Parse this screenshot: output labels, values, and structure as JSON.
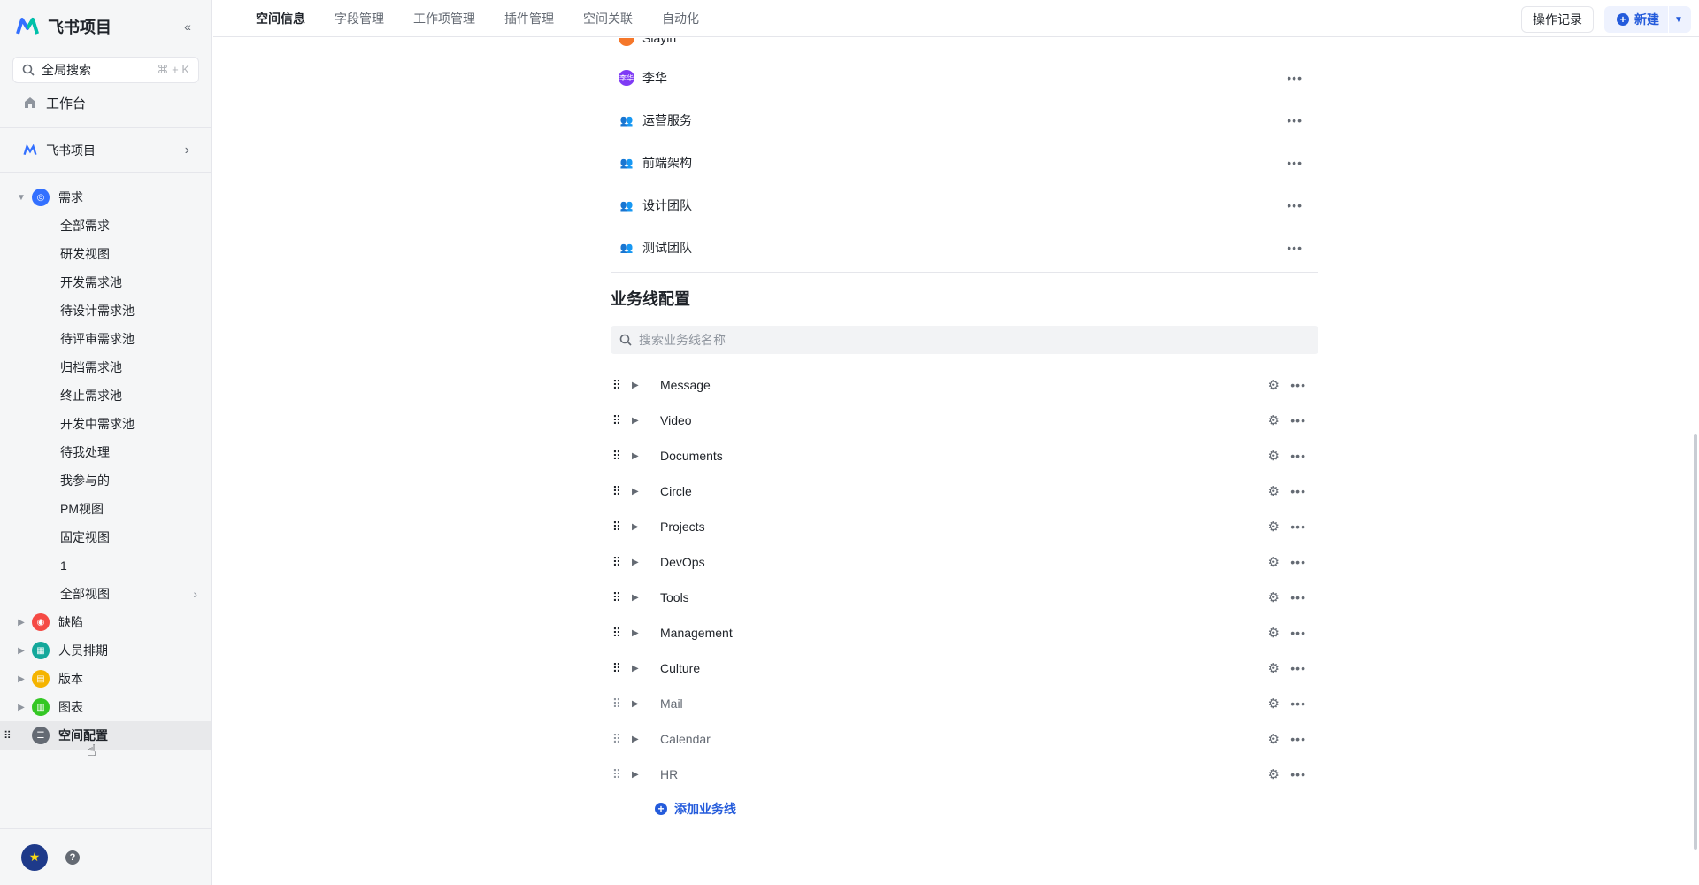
{
  "app": {
    "name": "飞书项目"
  },
  "sidebar": {
    "search_placeholder": "全局搜索",
    "search_shortcut": "⌘ + K",
    "workbench": "工作台",
    "space_name": "飞书项目",
    "groups": [
      {
        "label": "需求",
        "color": "#3370ff",
        "expanded": true
      },
      {
        "label": "缺陷",
        "color": "#f54a45"
      },
      {
        "label": "人员排期",
        "color": "#2ea121"
      },
      {
        "label": "版本",
        "color": "#f5b400"
      },
      {
        "label": "图表",
        "color": "#34c724"
      },
      {
        "label": "空间配置",
        "color": "#646a73",
        "active": true
      }
    ],
    "requirement_views": [
      "全部需求",
      "研发视图",
      "开发需求池",
      "待设计需求池",
      "待评审需求池",
      "归档需求池",
      "终止需求池",
      "开发中需求池",
      "待我处理",
      "我参与的",
      "PM视图",
      "固定视图",
      "1",
      "全部视图"
    ]
  },
  "header": {
    "tabs": [
      "空间信息",
      "字段管理",
      "工作项管理",
      "插件管理",
      "空间关联",
      "自动化"
    ],
    "ops_label": "操作记录",
    "new_label": "新建"
  },
  "members": [
    {
      "name": "Siayin",
      "type": "user",
      "color": "#f5772a"
    },
    {
      "name": "李华",
      "type": "user",
      "color": "#7f3bf5",
      "initials": "李华"
    },
    {
      "name": "运营服务",
      "type": "group"
    },
    {
      "name": "前端架构",
      "type": "group"
    },
    {
      "name": "设计团队",
      "type": "group"
    },
    {
      "name": "测试团队",
      "type": "group"
    }
  ],
  "business_lines": {
    "title": "业务线配置",
    "search_placeholder": "搜索业务线名称",
    "items": [
      {
        "name": "Message"
      },
      {
        "name": "Video"
      },
      {
        "name": "Documents"
      },
      {
        "name": "Circle"
      },
      {
        "name": "Projects"
      },
      {
        "name": "DevOps"
      },
      {
        "name": "Tools"
      },
      {
        "name": "Management"
      },
      {
        "name": "Culture"
      },
      {
        "name": "Mail",
        "muted": true
      },
      {
        "name": "Calendar",
        "muted": true
      },
      {
        "name": "HR",
        "muted": true
      }
    ],
    "add_label": "添加业务线"
  }
}
